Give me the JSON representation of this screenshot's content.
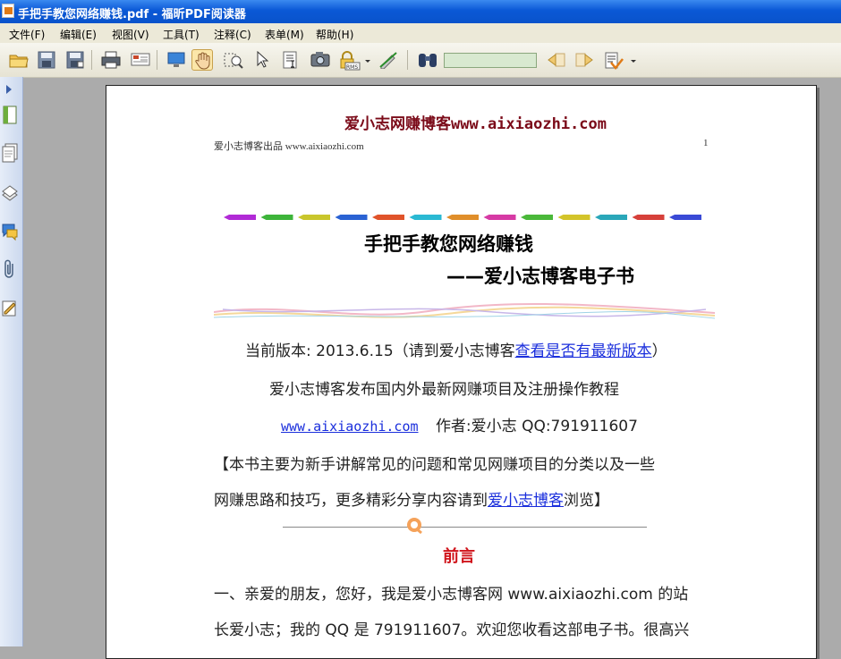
{
  "window": {
    "title": "手把手教您网络赚钱.pdf - 福昕PDF阅读器"
  },
  "menu": [
    "文件(F)",
    "编辑(E)",
    "视图(V)",
    "工具(T)",
    "注释(C)",
    "表单(M)",
    "帮助(H)"
  ],
  "toolbar": {
    "search_value": ""
  },
  "page": {
    "site_header": "爱小志网赚博客www.aixiaozhi.com",
    "header_left": "爱小志博客出品 www.aixiaozhi.com",
    "page_number": "1",
    "title": "手把手教您网络赚钱",
    "subtitle": "——爱小志博客电子书",
    "version_prefix": "当前版本: 2013.6.15（请到爱小志博客",
    "version_link": "查看是否有最新版本",
    "version_suffix": "）",
    "publish_line": "爱小志博客发布国内外最新网赚项目及注册操作教程",
    "site_link": "www.aixiaozhi.com",
    "author": "作者:爱小志 QQ:791911607",
    "intro1": "【本书主要为新手讲解常见的问题和常见网赚项目的分类以及一些",
    "intro2_prefix": "网赚思路和技巧，更多精彩分享内容请到",
    "intro2_link": "爱小志博客",
    "intro2_suffix": "浏览】",
    "preface_title": "前言",
    "para1_line1": "一、亲爱的朋友，您好，我是爱小志博客网 www.aixiaozhi.com 的站",
    "para1_line2": "长爱小志；我的 QQ 是 791911607。欢迎您收看这部电子书。很高兴"
  }
}
